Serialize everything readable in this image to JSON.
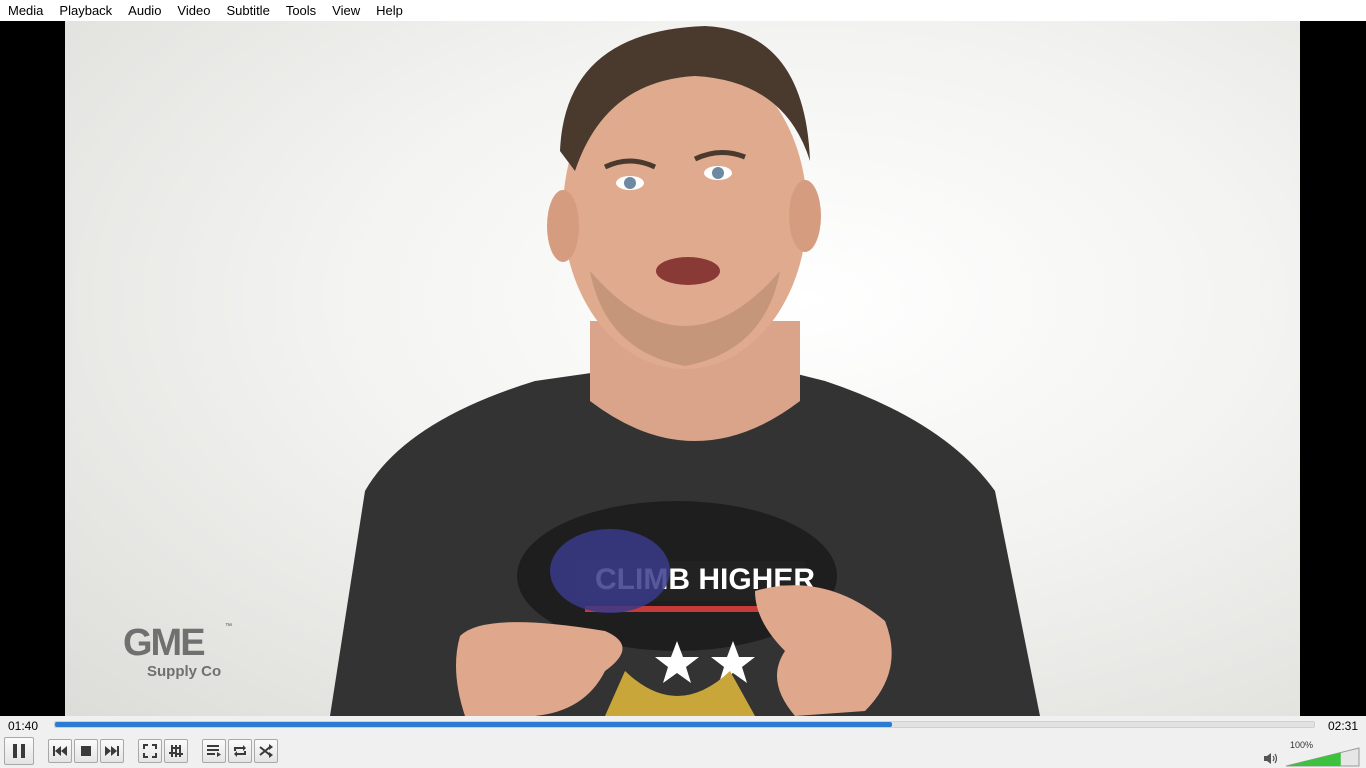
{
  "menu": [
    "Media",
    "Playback",
    "Audio",
    "Video",
    "Subtitle",
    "Tools",
    "View",
    "Help"
  ],
  "video": {
    "watermark_brand": "GME",
    "watermark_sub": "Supply Co",
    "watermark_tm": "™",
    "shirt_text": "CLIMB HIGHER"
  },
  "player": {
    "time_elapsed": "01:40",
    "time_total": "02:31",
    "progress_fraction": 0.665,
    "volume_label": "100%",
    "volume_fraction": 0.75,
    "accent_color": "#2b7bd3",
    "volume_color": "#3cc23c"
  },
  "icons": {
    "pause": "pause-icon",
    "previous": "previous-icon",
    "stop": "stop-icon",
    "next": "next-icon",
    "fullscreen": "fullscreen-icon",
    "extended_settings": "extended-settings-icon",
    "playlist": "playlist-icon",
    "loop": "loop-icon",
    "random": "random-icon",
    "speaker": "speaker-icon"
  }
}
